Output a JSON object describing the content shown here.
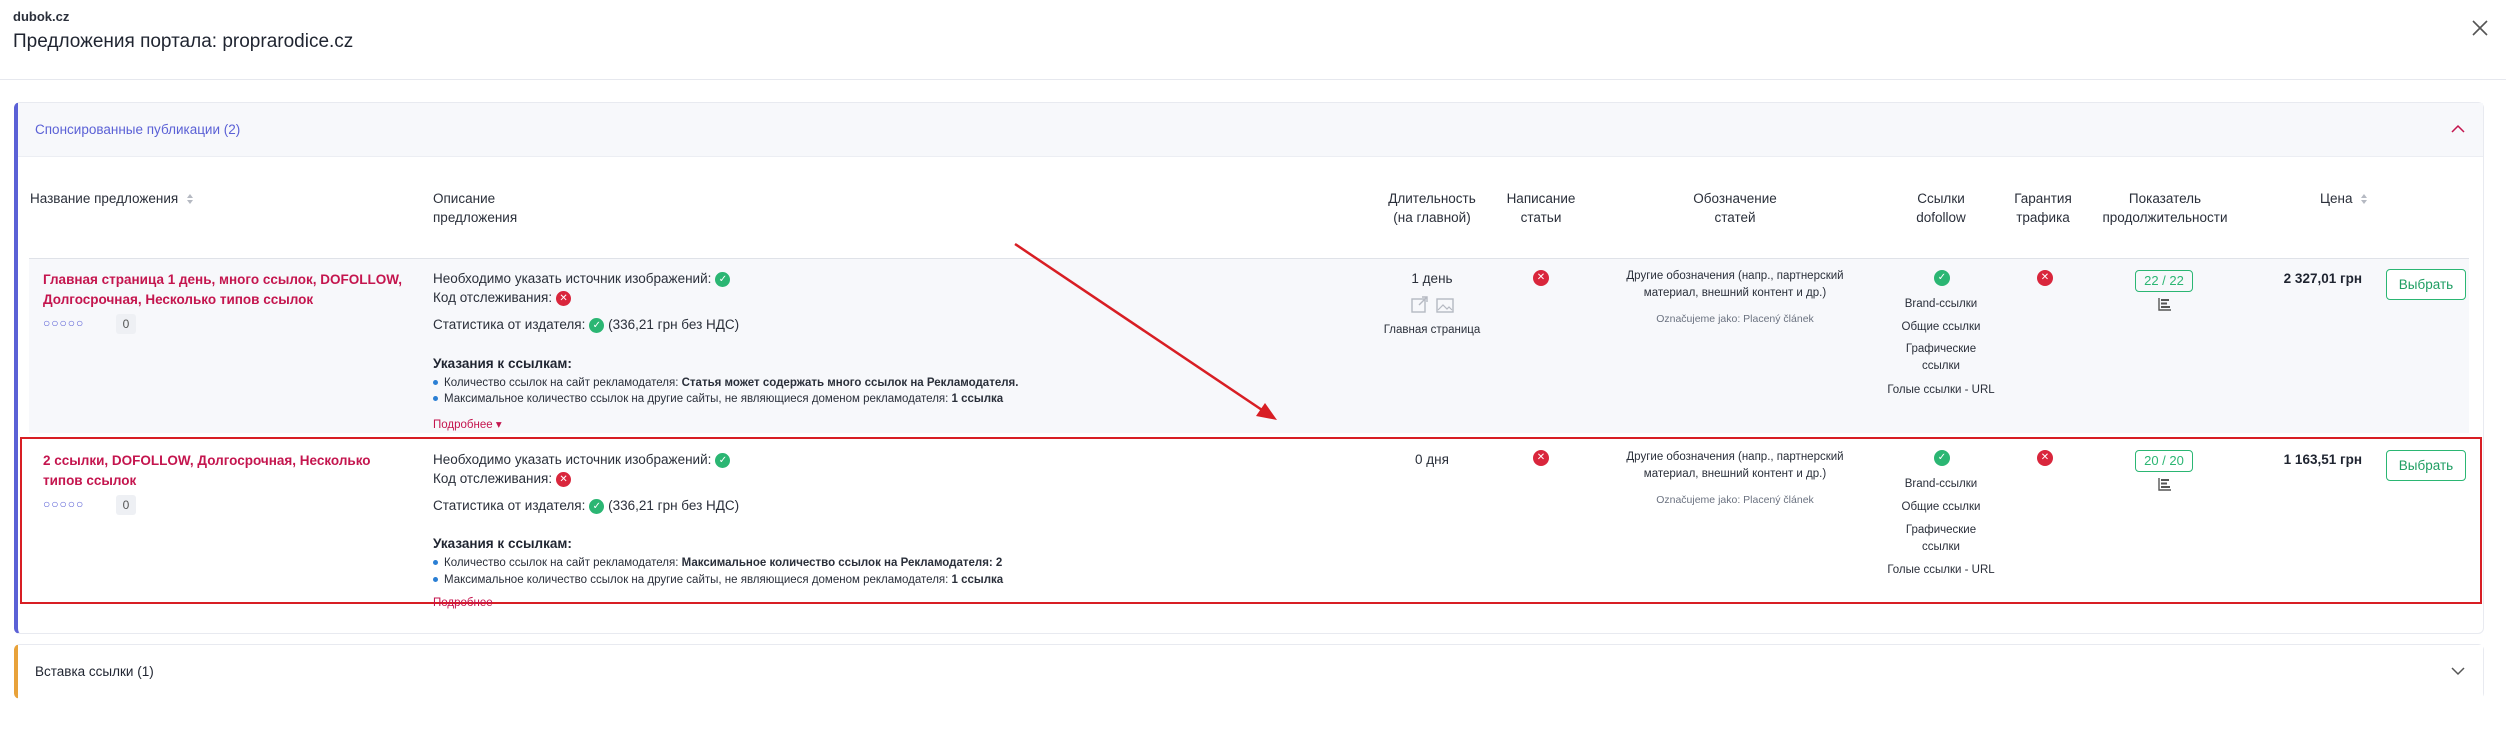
{
  "header": {
    "site": "dubok.cz",
    "title": "Предложения портала: proprarodice.cz"
  },
  "section1": {
    "title": "Спонсированные публикации (2)"
  },
  "section2": {
    "title": "Вставка ссылки (1)"
  },
  "columns": {
    "name": "Название предложения",
    "description": "Описание предложения",
    "duration": "Длительность (на главной)",
    "writing": "Написание статьи",
    "marking": "Обозначение статей",
    "links": "Ссылки dofollow",
    "traffic": "Гарантия трафика",
    "longevity": "Показатель продолжительности",
    "price": "Цена"
  },
  "labels": {
    "img_source": "Необходимо указать источник изображений:",
    "tracking": "Код отслеживания:",
    "stats": "Статистика от издателя:",
    "stats_value": "(336,21 грн без НДС)",
    "link_notes": "Указания к ссылкам:",
    "links_count_prefix": "Количество ссылок на сайт рекламодателя:",
    "links_other_prefix": "Максимальное количество ссылок на другие сайты, не являющиеся доменом рекламодателя:",
    "more": "Подробнее",
    "marking_text": "Другие обозначения (напр., партнерский материал, внешний контент и др.)",
    "marking_sub": "Označujeme jako: Placený článek",
    "link_types": [
      "Brand-ссылки",
      "Общие ссылки",
      "Графические ссылки",
      "Голые ссылки - URL"
    ],
    "choose": "Выбрать"
  },
  "offers": [
    {
      "name": "Главная страница 1 день, много ссылок, DOFOLLOW, Долгосрочная, Несколько типов ссылок",
      "rating_stars": "○○○○○",
      "rating_count": "0",
      "links_count_value": "Статья может содержать много ссылок на Рекламодателя.",
      "links_other_value": "1 ссылка",
      "duration": "1 день",
      "duration_sub": "Главная страница",
      "longevity": "22 / 22",
      "price": "2 327,01 грн"
    },
    {
      "name": "2 ссылки, DOFOLLOW, Долгосрочная, Несколько типов ссылок",
      "rating_stars": "○○○○○",
      "rating_count": "0",
      "links_count_value": "Максимальное количество ссылок на Рекламодателя: 2",
      "links_other_value": "1 ссылка",
      "duration": "0 дня",
      "duration_sub": "",
      "longevity": "20 / 20",
      "price": "1 163,51 грн"
    }
  ],
  "colors": {
    "accent": "#5b61d6",
    "brand_red": "#c4154e",
    "ok": "#2bb673",
    "no": "#d9263c",
    "highlight": "#d81e24",
    "section2_bar": "#e8a23a"
  }
}
